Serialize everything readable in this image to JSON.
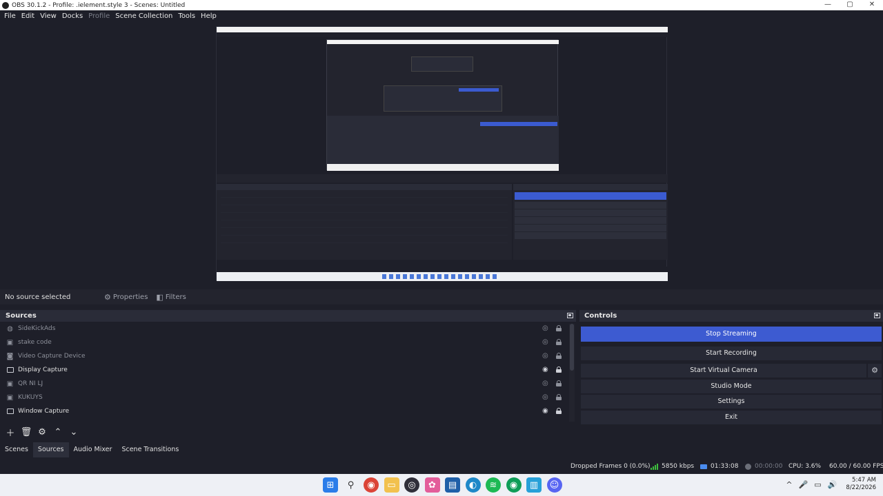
{
  "window": {
    "title": "OBS 30.1.2 - Profile: .ielement.style 3 - Scenes: Untitled",
    "controls": [
      "—",
      "▢",
      "✕"
    ]
  },
  "menu": [
    "File",
    "Edit",
    "View",
    "Docks",
    "Profile",
    "Scene Collection",
    "Tools",
    "Help"
  ],
  "context_bar": {
    "no_source": "No source selected",
    "properties": "Properties",
    "filters": "Filters"
  },
  "sources": {
    "title": "Sources",
    "items": [
      {
        "name": "SideKickAds",
        "icon": "browser-icon",
        "visible": false
      },
      {
        "name": "stake code",
        "icon": "image-icon",
        "visible": false
      },
      {
        "name": "Video Capture Device",
        "icon": "camera-icon",
        "visible": false
      },
      {
        "name": "Display Capture",
        "icon": "monitor-icon",
        "visible": true
      },
      {
        "name": "QR NI LJ",
        "icon": "image-icon",
        "visible": false
      },
      {
        "name": "KUKUYS",
        "icon": "image-icon",
        "visible": false
      },
      {
        "name": "Window Capture",
        "icon": "window-icon",
        "visible": true
      }
    ]
  },
  "dock_tabs": [
    "Scenes",
    "Sources",
    "Audio Mixer",
    "Scene Transitions"
  ],
  "controls": {
    "title": "Controls",
    "buttons": [
      "Stop Streaming",
      "Start Recording",
      "Start Virtual Camera",
      "Studio Mode",
      "Settings",
      "Exit"
    ]
  },
  "status": {
    "dropped_frames": "Dropped Frames 0 (0.0%)",
    "bitrate": "5850 kbps",
    "stream_time": "01:33:08",
    "record_time": "00:00:00",
    "cpu": "CPU: 3.6%",
    "fps": "60.00 / 60.00 FPS"
  },
  "taskbar": {
    "time": "5:47 AM",
    "date": "8/22/2026",
    "tray": [
      "^",
      "🎤",
      "▭",
      "🔊"
    ]
  },
  "colors": {
    "accent": "#3d5bd1",
    "background": "#1e1f29",
    "panel": "#272935"
  }
}
